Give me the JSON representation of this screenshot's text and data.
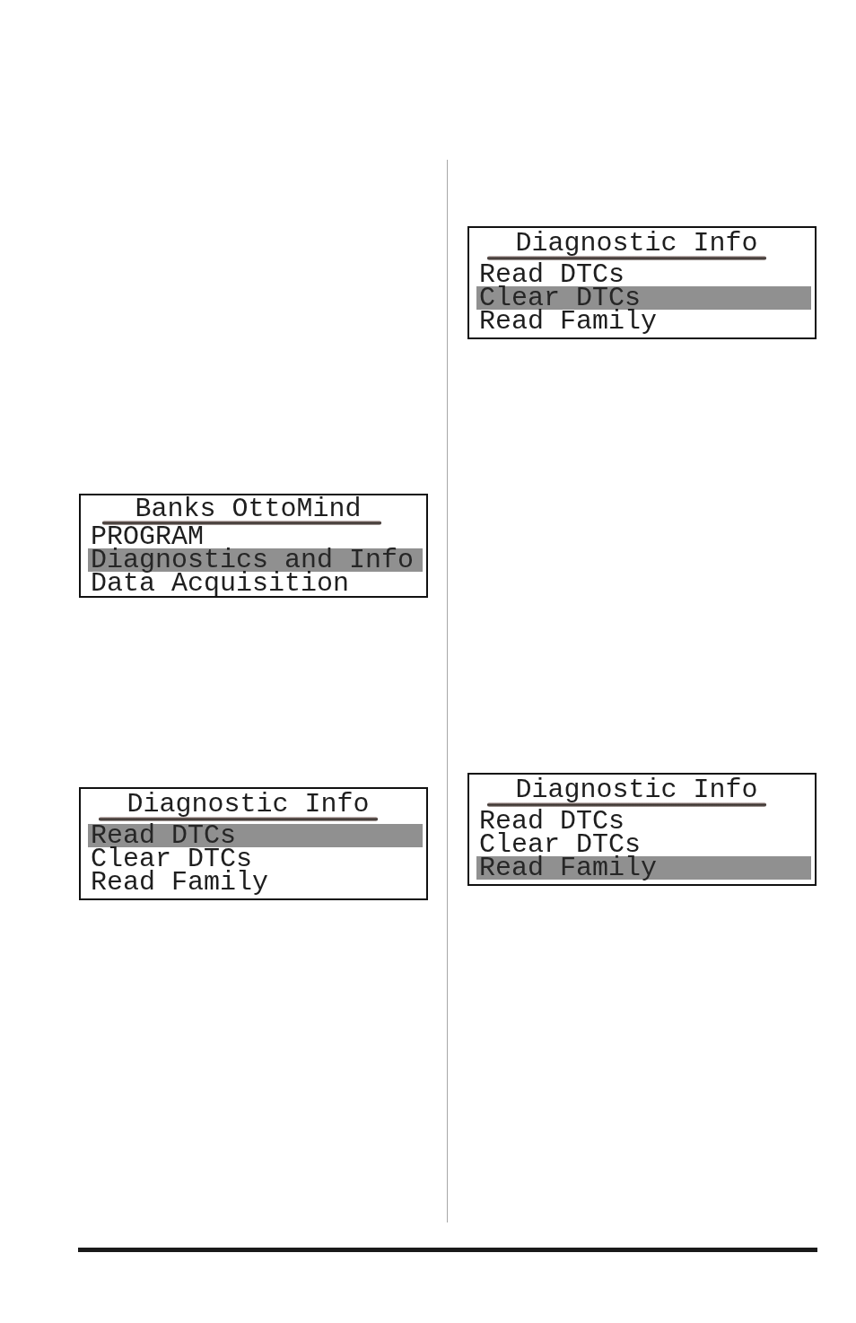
{
  "columns": [
    {
      "screens": [
        {
          "title": "Banks OttoMind",
          "items": [
            {
              "label": "PROGRAM",
              "selected": false
            },
            {
              "label": "Diagnostics and Info",
              "selected": true
            },
            {
              "label": "Data Acquisition",
              "selected": false
            }
          ]
        },
        {
          "title": "Diagnostic Info",
          "items": [
            {
              "label": "Read DTCs",
              "selected": true
            },
            {
              "label": "Clear DTCs",
              "selected": false
            },
            {
              "label": "Read Family",
              "selected": false
            }
          ]
        }
      ]
    },
    {
      "screens": [
        {
          "title": "Diagnostic Info",
          "items": [
            {
              "label": "Read DTCs",
              "selected": false
            },
            {
              "label": "Clear DTCs",
              "selected": true
            },
            {
              "label": "Read Family",
              "selected": false
            }
          ]
        },
        {
          "title": "Diagnostic Info",
          "items": [
            {
              "label": "Read DTCs",
              "selected": false
            },
            {
              "label": "Clear DTCs",
              "selected": false
            },
            {
              "label": "Read Family",
              "selected": true
            }
          ]
        }
      ]
    }
  ]
}
